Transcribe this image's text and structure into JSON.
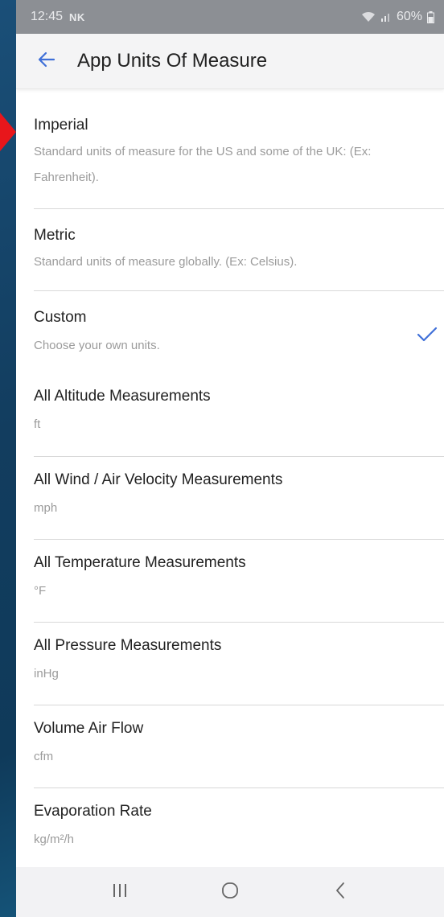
{
  "status_bar": {
    "time": "12:45",
    "carrier_badge": "NK",
    "battery": "60%",
    "icons": [
      "wifi-icon",
      "signal-icon",
      "battery-icon"
    ]
  },
  "header": {
    "title": "App Units Of Measure",
    "back_icon": "back-arrow-icon"
  },
  "options": [
    {
      "title": "Imperial",
      "description": "Standard units of measure for the US and some of the UK: (Ex: Fahrenheit)."
    },
    {
      "title": "Metric",
      "description": "Standard units of measure globally. (Ex: Celsius)."
    },
    {
      "title": "Custom",
      "description": "Choose your own units.",
      "selected": true
    }
  ],
  "measurements": [
    {
      "title": "All Altitude Measurements",
      "unit": "ft"
    },
    {
      "title": "All Wind / Air Velocity Measurements",
      "unit": "mph"
    },
    {
      "title": "All Temperature Measurements",
      "unit": "°F"
    },
    {
      "title": "All Pressure Measurements",
      "unit": "inHg"
    },
    {
      "title": "Volume Air Flow",
      "unit": "cfm"
    },
    {
      "title": "Evaporation Rate",
      "unit": "kg/m²/h"
    }
  ],
  "nav_bar": {
    "icons": [
      "recents-icon",
      "home-icon",
      "back-icon"
    ]
  },
  "colors": {
    "accent": "#3f6fd8",
    "status_bar": "#8c8f94",
    "annotation_arrow": "#e8161b"
  }
}
